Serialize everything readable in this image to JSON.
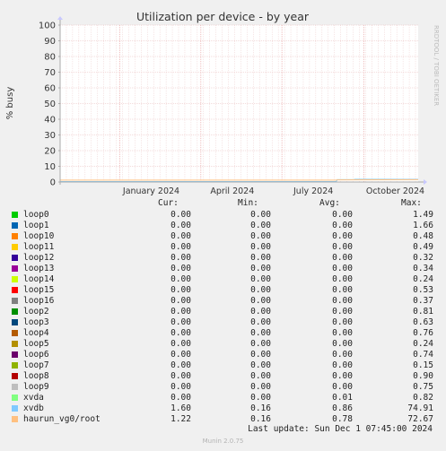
{
  "chart_data": {
    "type": "line",
    "title": "Utilization per device - by year",
    "ylabel": "% busy",
    "side_label": "RRDTOOL / TOBI OETIKER",
    "ylim": [
      0,
      100
    ],
    "yticks": [
      0,
      10,
      20,
      30,
      40,
      50,
      60,
      70,
      80,
      90,
      100
    ],
    "xlim": [
      "2023-10-26",
      "2024-12-01"
    ],
    "xticks": [
      {
        "label": "January 2024",
        "date": "2024-01-01"
      },
      {
        "label": "April 2024",
        "date": "2024-04-01"
      },
      {
        "label": "July 2024",
        "date": "2024-07-01"
      },
      {
        "label": "October 2024",
        "date": "2024-10-01"
      }
    ],
    "grid": true,
    "series": [
      {
        "name": "xvdb",
        "color": "#7ec8f5",
        "x": [
          "2023-10-26",
          "2024-08-31",
          "2024-09-01",
          "2024-09-20",
          "2024-09-21",
          "2024-12-01"
        ],
        "values": [
          0.3,
          0.3,
          1.5,
          1.5,
          1.7,
          1.7
        ]
      },
      {
        "name": "haurun_vg0/root",
        "color": "#ffc080",
        "x": [
          "2023-10-26",
          "2024-08-31",
          "2024-09-01",
          "2024-12-01"
        ],
        "values": [
          1.2,
          1.2,
          1.4,
          1.5
        ]
      }
    ]
  },
  "legend": {
    "headers": {
      "cur": "Cur:",
      "min": "Min:",
      "avg": "Avg:",
      "max": "Max:"
    },
    "rows": [
      {
        "name": "loop0",
        "color": "#00cc00",
        "cur": "0.00",
        "min": "0.00",
        "avg": "0.00",
        "max": "1.49"
      },
      {
        "name": "loop1",
        "color": "#0066b3",
        "cur": "0.00",
        "min": "0.00",
        "avg": "0.00",
        "max": "1.66"
      },
      {
        "name": "loop10",
        "color": "#ff8000",
        "cur": "0.00",
        "min": "0.00",
        "avg": "0.00",
        "max": "0.48"
      },
      {
        "name": "loop11",
        "color": "#ffcc00",
        "cur": "0.00",
        "min": "0.00",
        "avg": "0.00",
        "max": "0.49"
      },
      {
        "name": "loop12",
        "color": "#330099",
        "cur": "0.00",
        "min": "0.00",
        "avg": "0.00",
        "max": "0.32"
      },
      {
        "name": "loop13",
        "color": "#990099",
        "cur": "0.00",
        "min": "0.00",
        "avg": "0.00",
        "max": "0.34"
      },
      {
        "name": "loop14",
        "color": "#ccff00",
        "cur": "0.00",
        "min": "0.00",
        "avg": "0.00",
        "max": "0.24"
      },
      {
        "name": "loop15",
        "color": "#ff0000",
        "cur": "0.00",
        "min": "0.00",
        "avg": "0.00",
        "max": "0.53"
      },
      {
        "name": "loop16",
        "color": "#808080",
        "cur": "0.00",
        "min": "0.00",
        "avg": "0.00",
        "max": "0.37"
      },
      {
        "name": "loop2",
        "color": "#008f00",
        "cur": "0.00",
        "min": "0.00",
        "avg": "0.00",
        "max": "0.81"
      },
      {
        "name": "loop3",
        "color": "#00487d",
        "cur": "0.00",
        "min": "0.00",
        "avg": "0.00",
        "max": "0.63"
      },
      {
        "name": "loop4",
        "color": "#b35a00",
        "cur": "0.00",
        "min": "0.00",
        "avg": "0.00",
        "max": "0.76"
      },
      {
        "name": "loop5",
        "color": "#b38f00",
        "cur": "0.00",
        "min": "0.00",
        "avg": "0.00",
        "max": "0.24"
      },
      {
        "name": "loop6",
        "color": "#6b006b",
        "cur": "0.00",
        "min": "0.00",
        "avg": "0.00",
        "max": "0.74"
      },
      {
        "name": "loop7",
        "color": "#8fb300",
        "cur": "0.00",
        "min": "0.00",
        "avg": "0.00",
        "max": "0.15"
      },
      {
        "name": "loop8",
        "color": "#b30000",
        "cur": "0.00",
        "min": "0.00",
        "avg": "0.00",
        "max": "0.90"
      },
      {
        "name": "loop9",
        "color": "#bebebe",
        "cur": "0.00",
        "min": "0.00",
        "avg": "0.00",
        "max": "0.75"
      },
      {
        "name": "xvda",
        "color": "#80ff80",
        "cur": "0.00",
        "min": "0.00",
        "avg": "0.01",
        "max": "0.82"
      },
      {
        "name": "xvdb",
        "color": "#80c9ff",
        "cur": "1.60",
        "min": "0.16",
        "avg": "0.86",
        "max": "74.91"
      },
      {
        "name": "haurun_vg0/root",
        "color": "#ffc080",
        "cur": "1.22",
        "min": "0.16",
        "avg": "0.78",
        "max": "72.67"
      }
    ]
  },
  "last_update": "Last update: Sun Dec  1 07:45:00 2024",
  "footer": "Munin 2.0.75"
}
